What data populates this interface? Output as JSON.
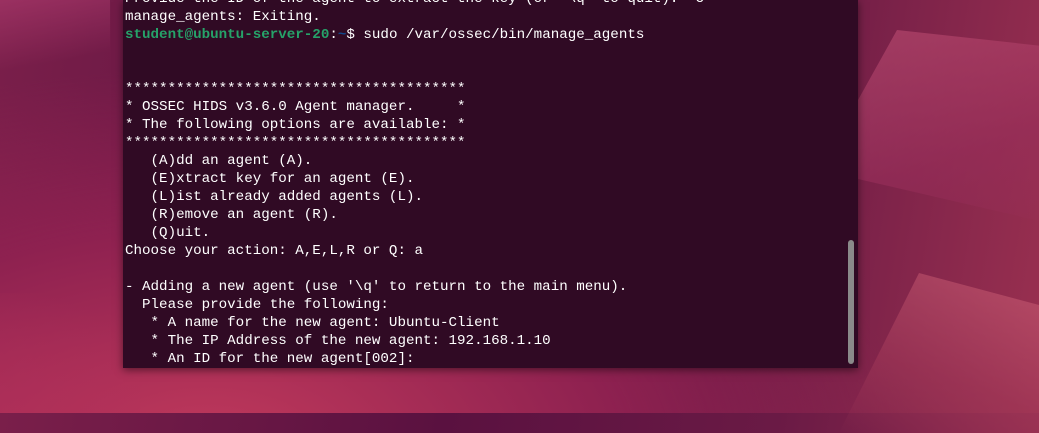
{
  "terminal": {
    "lines": [
      "Provide the ID of the agent to extract the key (or '\\q' to quit): ^C",
      "manage_agents: Exiting.",
      "",
      "",
      "",
      "****************************************",
      "* OSSEC HIDS v3.6.0 Agent manager.     *",
      "* The following options are available: *",
      "****************************************",
      "   (A)dd an agent (A).",
      "   (E)xtract key for an agent (E).",
      "   (L)ist already added agents (L).",
      "   (R)emove an agent (R).",
      "   (Q)uit.",
      "Choose your action: A,E,L,R or Q: a",
      "",
      "- Adding a new agent (use '\\q' to return to the main menu).",
      "  Please provide the following:",
      "   * A name for the new agent: Ubuntu-Client",
      "   * The IP Address of the new agent: 192.168.1.10",
      "   * An ID for the new agent[002]:"
    ],
    "prompt": {
      "user_host": "student@ubuntu-server-20",
      "separator": ":",
      "path": "~",
      "symbol": "$ ",
      "command": "sudo /var/ossec/bin/manage_agents"
    },
    "colors": {
      "background": "#300a24",
      "prompt_user": "#26a269",
      "prompt_path": "#12488b",
      "text": "#ffffff"
    }
  }
}
